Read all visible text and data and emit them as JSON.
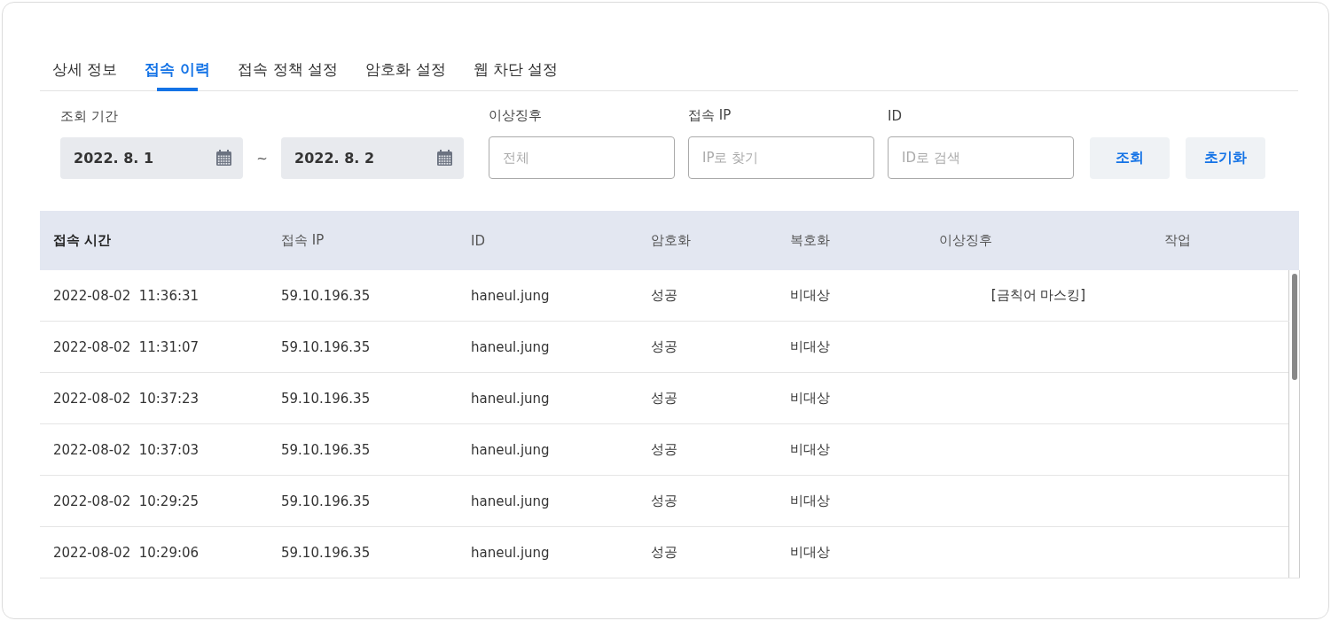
{
  "tabs": [
    {
      "label": "상세 정보",
      "selected": false
    },
    {
      "label": "접속 이력",
      "selected": true
    },
    {
      "label": "접속 정책 설정",
      "selected": false
    },
    {
      "label": "암호화 설정",
      "selected": false
    },
    {
      "label": "웹 차단 설정",
      "selected": false
    }
  ],
  "filters": {
    "period": {
      "label": "조회 기간",
      "from": "2022. 8. 1",
      "separator": "~",
      "to": "2022. 8. 2"
    },
    "anomaly": {
      "label": "이상징후",
      "placeholder": "전체"
    },
    "ip": {
      "label": "접속 IP",
      "placeholder": "IP로 찾기"
    },
    "id": {
      "label": "ID",
      "placeholder": "ID로 검색"
    },
    "buttons": [
      "조회",
      "초기화"
    ]
  },
  "table": {
    "columns": [
      "접속 시간",
      "접속 IP",
      "ID",
      "암호화",
      "복호화",
      "이상징후",
      "작업"
    ],
    "rows": [
      [
        "2022-08-02  11:36:31",
        "59.10.196.35",
        "haneul.jung",
        "성공",
        "비대상",
        "[금칙어 마스킹]"
      ],
      [
        "2022-08-02  11:31:07",
        "59.10.196.35",
        "haneul.jung",
        "성공",
        "비대상",
        ""
      ],
      [
        "2022-08-02  10:37:23",
        "59.10.196.35",
        "haneul.jung",
        "성공",
        "비대상",
        ""
      ],
      [
        "2022-08-02  10:37:03",
        "59.10.196.35",
        "haneul.jung",
        "성공",
        "비대상",
        ""
      ],
      [
        "2022-08-02  10:29:25",
        "59.10.196.35",
        "haneul.jung",
        "성공",
        "비대상",
        ""
      ],
      [
        "2022-08-02  10:29:06",
        "59.10.196.35",
        "haneul.jung",
        "성공",
        "비대상",
        ""
      ]
    ]
  }
}
